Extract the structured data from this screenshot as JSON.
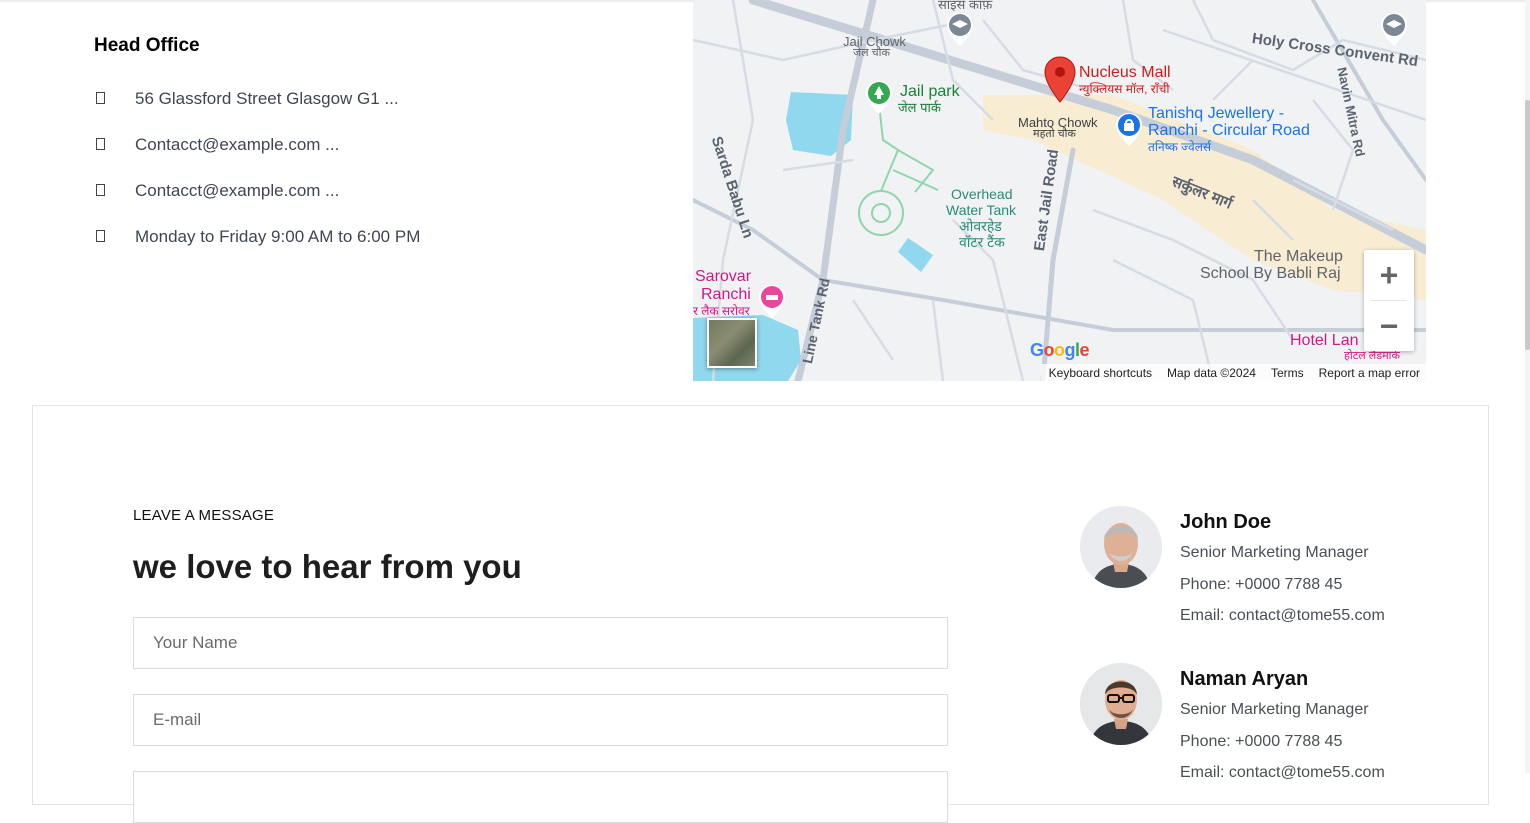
{
  "head_office": {
    "title": "Head Office",
    "items": [
      {
        "icon": "map-marker-icon",
        "text": "56 Glassford Street Glasgow G1 ..."
      },
      {
        "icon": "envelope-icon",
        "text": "Contacct@example.com ..."
      },
      {
        "icon": "envelope-icon",
        "text": "Contacct@example.com ..."
      },
      {
        "icon": "clock-icon",
        "text": "Monday to Friday 9:00 AM to 6:00 PM"
      }
    ]
  },
  "map": {
    "labels": {
      "jail_chowk": "Jail Chowk",
      "jail_chowk_hi": "जेल चौक",
      "jail_park": "Jail park",
      "jail_park_hi": "जेल पार्क",
      "holy_cross": "Holy Cross Convent Rd",
      "nucleus": "Nucleus Mall",
      "nucleus_hi": "न्युक्लियस मॉल, राँची",
      "mahto": "Mahto Chowk",
      "mahto_hi": "महतो चौक",
      "tanishq1": "Tanishq Jewellery -",
      "tanishq2": "Ranchi - Circular Road",
      "tanishq_hi": "तनिष्क ज्वेलर्स",
      "circular_hi": "सर्कुलर मार्ग",
      "sarda": "Sarda Babu Ln",
      "overhead1": "Overhead",
      "overhead2": "Water Tank",
      "overhead_hi1": "ओवरहेड",
      "overhead_hi2": "वॉटर टैंक",
      "east_jail": "East Jail Road",
      "navin": "Navin Mitra Rd",
      "makeup1": "The Makeup",
      "makeup2": "School By Babli Raj",
      "sarovar1": "Sarovar",
      "sarovar2": "Ranchi",
      "sarovar_hi": "र लैक सरोवर",
      "line_tank": "Line Tank Rd",
      "hotel_lan": "Hotel Lan",
      "hotel_lan_hi": "होटल लैंडमार्क",
      "top_hi": "साइंस कॉफ़"
    },
    "zoom_in": "+",
    "zoom_out": "−",
    "google": "Google",
    "footer": {
      "shortcuts": "Keyboard shortcuts",
      "map_data": "Map data ©2024",
      "terms": "Terms",
      "report": "Report a map error"
    }
  },
  "contact": {
    "eyebrow": "LEAVE A MESSAGE",
    "heading": "we love to hear from you",
    "name_placeholder": "Your Name",
    "email_placeholder": "E-mail"
  },
  "people": [
    {
      "name": "John Doe",
      "role": "Senior Marketing Manager",
      "phone": "Phone: +0000 7788 45",
      "email": "Email: contact@tome55.com"
    },
    {
      "name": "Naman Aryan",
      "role": "Senior Marketing Manager",
      "phone": "Phone: +0000 7788 45",
      "email": "Email: contact@tome55.com"
    }
  ],
  "colors": {
    "map_bg": "#f1f2f4",
    "road": "#c5cdd8",
    "water": "#8fd8ee",
    "highlight": "#f9ebcc",
    "park": "#6fcf97"
  }
}
